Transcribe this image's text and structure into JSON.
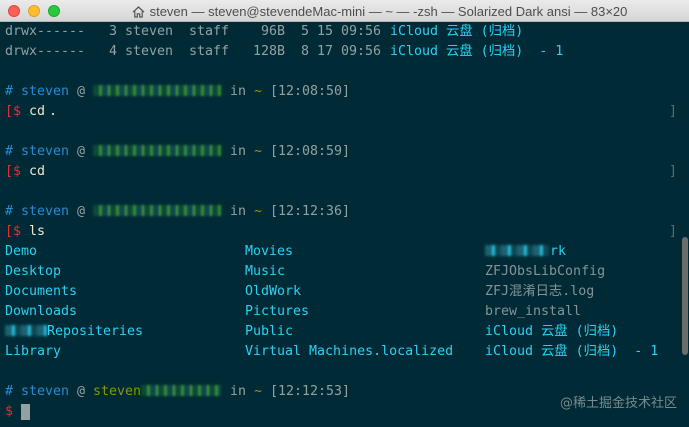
{
  "window": {
    "title": "steven — steven@stevendeMac-mini — ~ — -zsh — Solarized Dark ansi — 83×20",
    "colors": {
      "background": "#002b36",
      "prompt_hash": "#268bd2",
      "user": "#268bd2",
      "host": "#859900",
      "path": "#b58900",
      "error_bracket": "#dc322f",
      "dir": "#2bd1f2"
    }
  },
  "terminal": {
    "ls_top": [
      {
        "perms": "drwx------",
        "links": "3",
        "user": "steven",
        "group": "staff",
        "size": "96B",
        "date": "5 15 09:56",
        "name": "iCloud 云盘 (归档)"
      },
      {
        "perms": "drwx------",
        "links": "4",
        "user": "steven",
        "group": "staff",
        "size": "128B",
        "date": "8 17 09:56",
        "name": "iCloud 云盘 (归档)  - 1"
      }
    ],
    "prompts": [
      {
        "hash": "#",
        "user": "steven",
        "at": "@",
        "host_visible": "",
        "in": "in",
        "path": "~",
        "time": "[12:08:50]",
        "bracket": "[$",
        "cmd": "cd",
        "arg": "."
      },
      {
        "hash": "#",
        "user": "steven",
        "at": "@",
        "host_visible": "",
        "in": "in",
        "path": "~",
        "time": "[12:08:59]",
        "bracket": "[$",
        "cmd": "cd",
        "arg": ""
      },
      {
        "hash": "#",
        "user": "steven",
        "at": "@",
        "host_visible": "",
        "in": "in",
        "path": "~",
        "time": "[12:12:36]",
        "bracket": "[$",
        "cmd": "ls",
        "arg": ""
      },
      {
        "hash": "#",
        "user": "steven",
        "at": "@",
        "host_visible": "steven",
        "in": "in",
        "path": "~",
        "time": "[12:12:53]",
        "bracket": "$",
        "cmd": "",
        "arg": ""
      }
    ],
    "bracket_right": "]",
    "ls_columns": [
      [
        "Demo",
        "Desktop",
        "Documents",
        "Downloads",
        "Repositeries",
        "Library"
      ],
      [
        "Movies",
        "Music",
        "OldWork",
        "Pictures",
        "Public",
        "Virtual Machines.localized"
      ],
      [
        "rk",
        "ZFJObsLibConfig",
        "ZFJ混淆日志.log",
        "brew_install",
        "iCloud 云盘 (归档)",
        "iCloud 云盘 (归档)  - 1"
      ]
    ]
  },
  "watermark": "@稀土掘金技术社区"
}
